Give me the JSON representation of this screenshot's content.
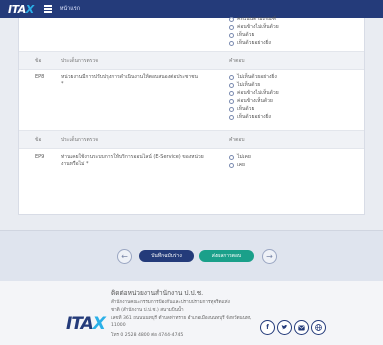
{
  "topbar": {
    "logo_text": "ITA",
    "logo_x": "X",
    "nav_label": "หน้าแรก"
  },
  "q_prev": {
    "options": [
      "คะแนนตามเกณฑ์",
      "ค่อนข้างไม่เห็นด้วย",
      "เห็นด้วย",
      "เห็นด้วยอย่างยิ่ง"
    ]
  },
  "table_header_1": {
    "col_id": "ข้อ",
    "col_question": "ประเด็นการตรวจ",
    "col_answer": "คำตอบ"
  },
  "q_ep8": {
    "id": "EP8",
    "question_line1": "หน่วยงานมีการปรับปรุงการดำเนินงานให้ตอบสนองต่อประชาชน",
    "question_line2": "*",
    "options": [
      "ไม่เห็นด้วยอย่างยิ่ง",
      "ไม่เห็นด้วย",
      "ค่อนข้างไม่เห็นด้วย",
      "ค่อนข้างเห็นด้วย",
      "เห็นด้วย",
      "เห็นด้วยอย่างยิ่ง"
    ]
  },
  "table_header_2": {
    "col_id": "ข้อ",
    "col_question": "ประเด็นการตรวจ",
    "col_answer": "คำตอบ"
  },
  "q_ep9": {
    "id": "EP9",
    "question_line1": "ท่านเคยใช้งานระบบการให้บริการออนไลน์ (E-Service) ของหน่วย",
    "question_line2": "งานหรือไม่ *",
    "options": [
      "ไม่เคย",
      "เคย"
    ]
  },
  "pager": {
    "prev_icon": "←",
    "next_icon": "→",
    "save_label": "บันทึกฉบับร่าง",
    "submit_label": "ส่งผลการตอบ"
  },
  "footer": {
    "title": "ติดต่อหน่วยงานสำนักงาน ป.ป.ช.",
    "line1": "สำนักงานคณะกรรมการป้องกันและปราบปรามการทุจริตแห่ง",
    "line2": "ชาติ (สำนักงาน ป.ป.ช.) สนามบินน้ำ",
    "line3": "เลขที่ 361 ถนนนนทบุรี ตำบลท่าทราย อำเภอเมืองนนทบุรี จังหวัดนนทบุรี",
    "line4": "11000",
    "line5": "โทร 0 2528 4800 ต่อ 4744-4745",
    "socials": [
      "f",
      "t",
      "m",
      "w"
    ]
  },
  "colors": {
    "primary": "#243b7a",
    "accent_green": "#1aa08a",
    "accent_blue": "#2ab0e8"
  }
}
